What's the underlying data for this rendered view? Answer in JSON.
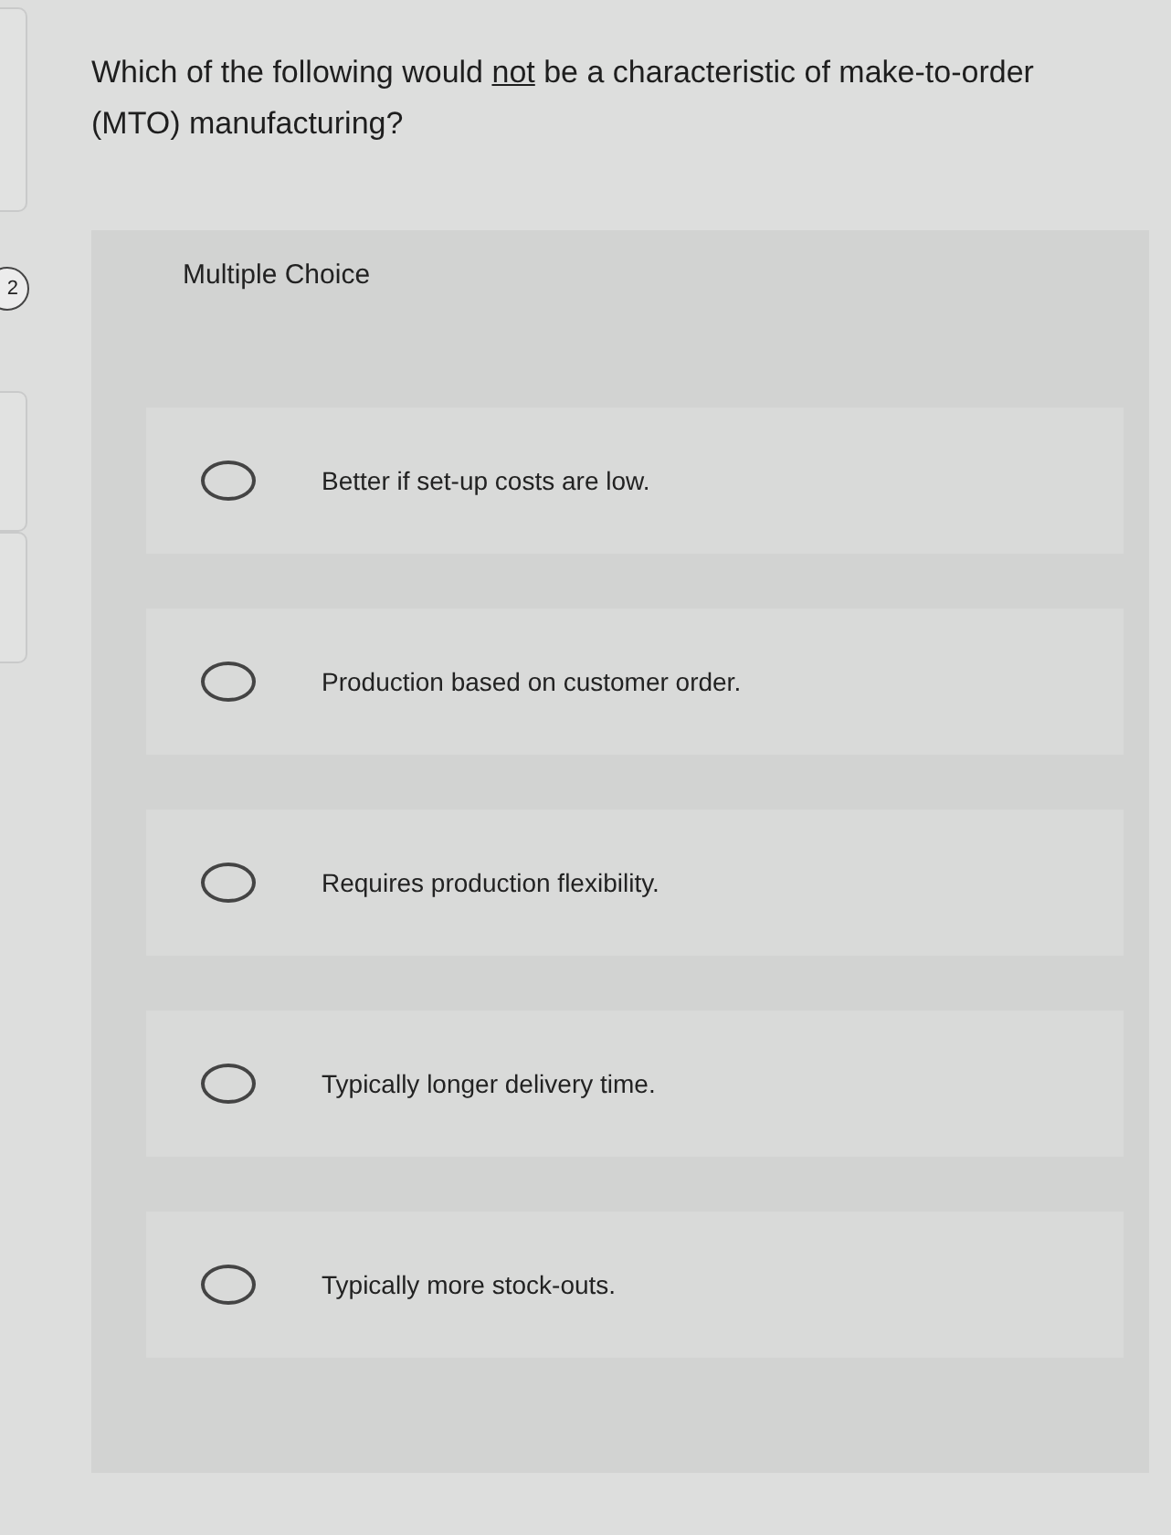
{
  "question_number": "2",
  "question": {
    "before": "Which of the following would ",
    "underlined": "not",
    "after": " be a characteristic of make-to-order (MTO) manufacturing?"
  },
  "answer_type": "Multiple Choice",
  "options": [
    {
      "label": "Better if set-up costs are low.",
      "selected": false
    },
    {
      "label": "Production based on customer order.",
      "selected": false
    },
    {
      "label": "Requires production flexibility.",
      "selected": false
    },
    {
      "label": "Typically longer delivery time.",
      "selected": false
    },
    {
      "label": "Typically more stock-outs.",
      "selected": false
    }
  ]
}
